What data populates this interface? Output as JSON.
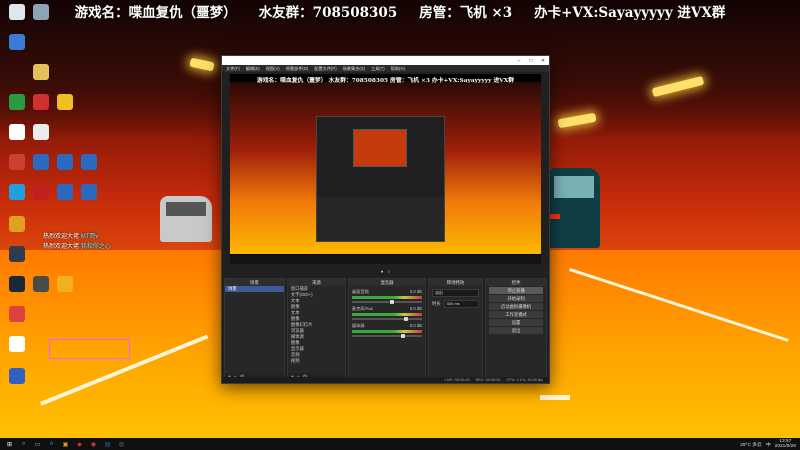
{
  "banner": {
    "game": "游戏名：喋血复仇（噩梦）",
    "group": "水友群：708508305",
    "manager": "房管：飞机 ×3",
    "contact": "办卡+VX:Sayayyyyy 进VX群"
  },
  "desktop": {
    "icons": [
      {
        "label": "",
        "color": "#dfe6ee"
      },
      {
        "label": "",
        "color": "#8ea2b8"
      },
      {
        "label": "",
        "color": "#3a7bd5"
      },
      {
        "label": "",
        "color": "#e4c05a"
      },
      {
        "label": "",
        "color": "#2a9c3e"
      },
      {
        "label": "",
        "color": "#d03030"
      },
      {
        "label": "",
        "color": "#f0c020"
      },
      {
        "label": "",
        "color": "#ffffff"
      },
      {
        "label": "",
        "color": "#ececec"
      },
      {
        "label": "",
        "color": "#d04030"
      },
      {
        "label": "",
        "color": "#2a6bc0"
      },
      {
        "label": "",
        "color": "#2a6bc0"
      },
      {
        "label": "",
        "color": "#2a6bc0"
      },
      {
        "label": "",
        "color": "#20a0e0"
      },
      {
        "label": "",
        "color": "#c02020"
      },
      {
        "label": "",
        "color": "#2a6bc0"
      },
      {
        "label": "",
        "color": "#2a6bc0"
      },
      {
        "label": "",
        "color": "#e0a020"
      },
      {
        "label": "",
        "color": "#303a50"
      },
      {
        "label": "",
        "color": "#1b2838"
      },
      {
        "label": "",
        "color": "#4a4a4a"
      },
      {
        "label": "",
        "color": "#f0b020"
      },
      {
        "label": "",
        "color": "#e04040"
      },
      {
        "label": "",
        "color": "#ffffff"
      },
      {
        "label": "",
        "color": "#3060c0"
      }
    ],
    "stream_messages": [
      {
        "user": "热烈欢迎大佬",
        "highlight": "MT哥v"
      },
      {
        "user": "热烈欢迎大佬",
        "highlight": "我和你之心"
      }
    ]
  },
  "obs": {
    "menu": [
      "文件(F)",
      "编辑(E)",
      "视图(V)",
      "停靠部件(D)",
      "配置文件(P)",
      "场景集合(S)",
      "工具(T)",
      "帮助(H)"
    ],
    "preview_banner": "游戏名：喋血复仇（噩梦）   水友群：708508305   房管：飞机 ×3   办卡+VX:Sayayyyyy 进VX群",
    "toolbar_items": [
      "●",
      "○"
    ],
    "docks": {
      "scenes": {
        "title": "场景",
        "items": [
          "场景"
        ]
      },
      "sources": {
        "title": "来源",
        "items": [
          "窗口捕获",
          "文字(GDI+)",
          "文本",
          "图像",
          "文本",
          "图像",
          "图像幻灯片",
          "浏览器",
          "媒体源",
          "图像",
          "显示器",
          "音频",
          "视频"
        ]
      },
      "mixer": {
        "title": "混音器",
        "tracks": [
          {
            "name": "桌面音频",
            "db": "0.0 dB",
            "fader": 0.55
          },
          {
            "name": "麦克风/Aux",
            "db": "0.0 dB",
            "fader": 0.75
          },
          {
            "name": "媒体源",
            "db": "0.0 dB",
            "fader": 0.7
          }
        ]
      },
      "transitions": {
        "title": "转场特效",
        "transition_label": "淡出",
        "duration_label": "时长",
        "duration_value": "300 ms"
      },
      "controls": {
        "title": "控件",
        "buttons": [
          "停止直播",
          "开始录制",
          "启动虚拟摄像机",
          "工作室模式",
          "设置",
          "退出"
        ]
      }
    },
    "status": [
      "LIVE: 00:00:00",
      "REC: 00:00:00",
      "CPU: 2.1%, 30.00 fps"
    ]
  },
  "taskbar": {
    "icons": [
      "⊞",
      "○",
      "▭",
      "e",
      "▣",
      "◆",
      "◉",
      "▤",
      "◎"
    ],
    "tray_weather": "29°C 多云",
    "tray_lang": "中",
    "clock_time": "13:57",
    "clock_date": "2021/8/26"
  }
}
